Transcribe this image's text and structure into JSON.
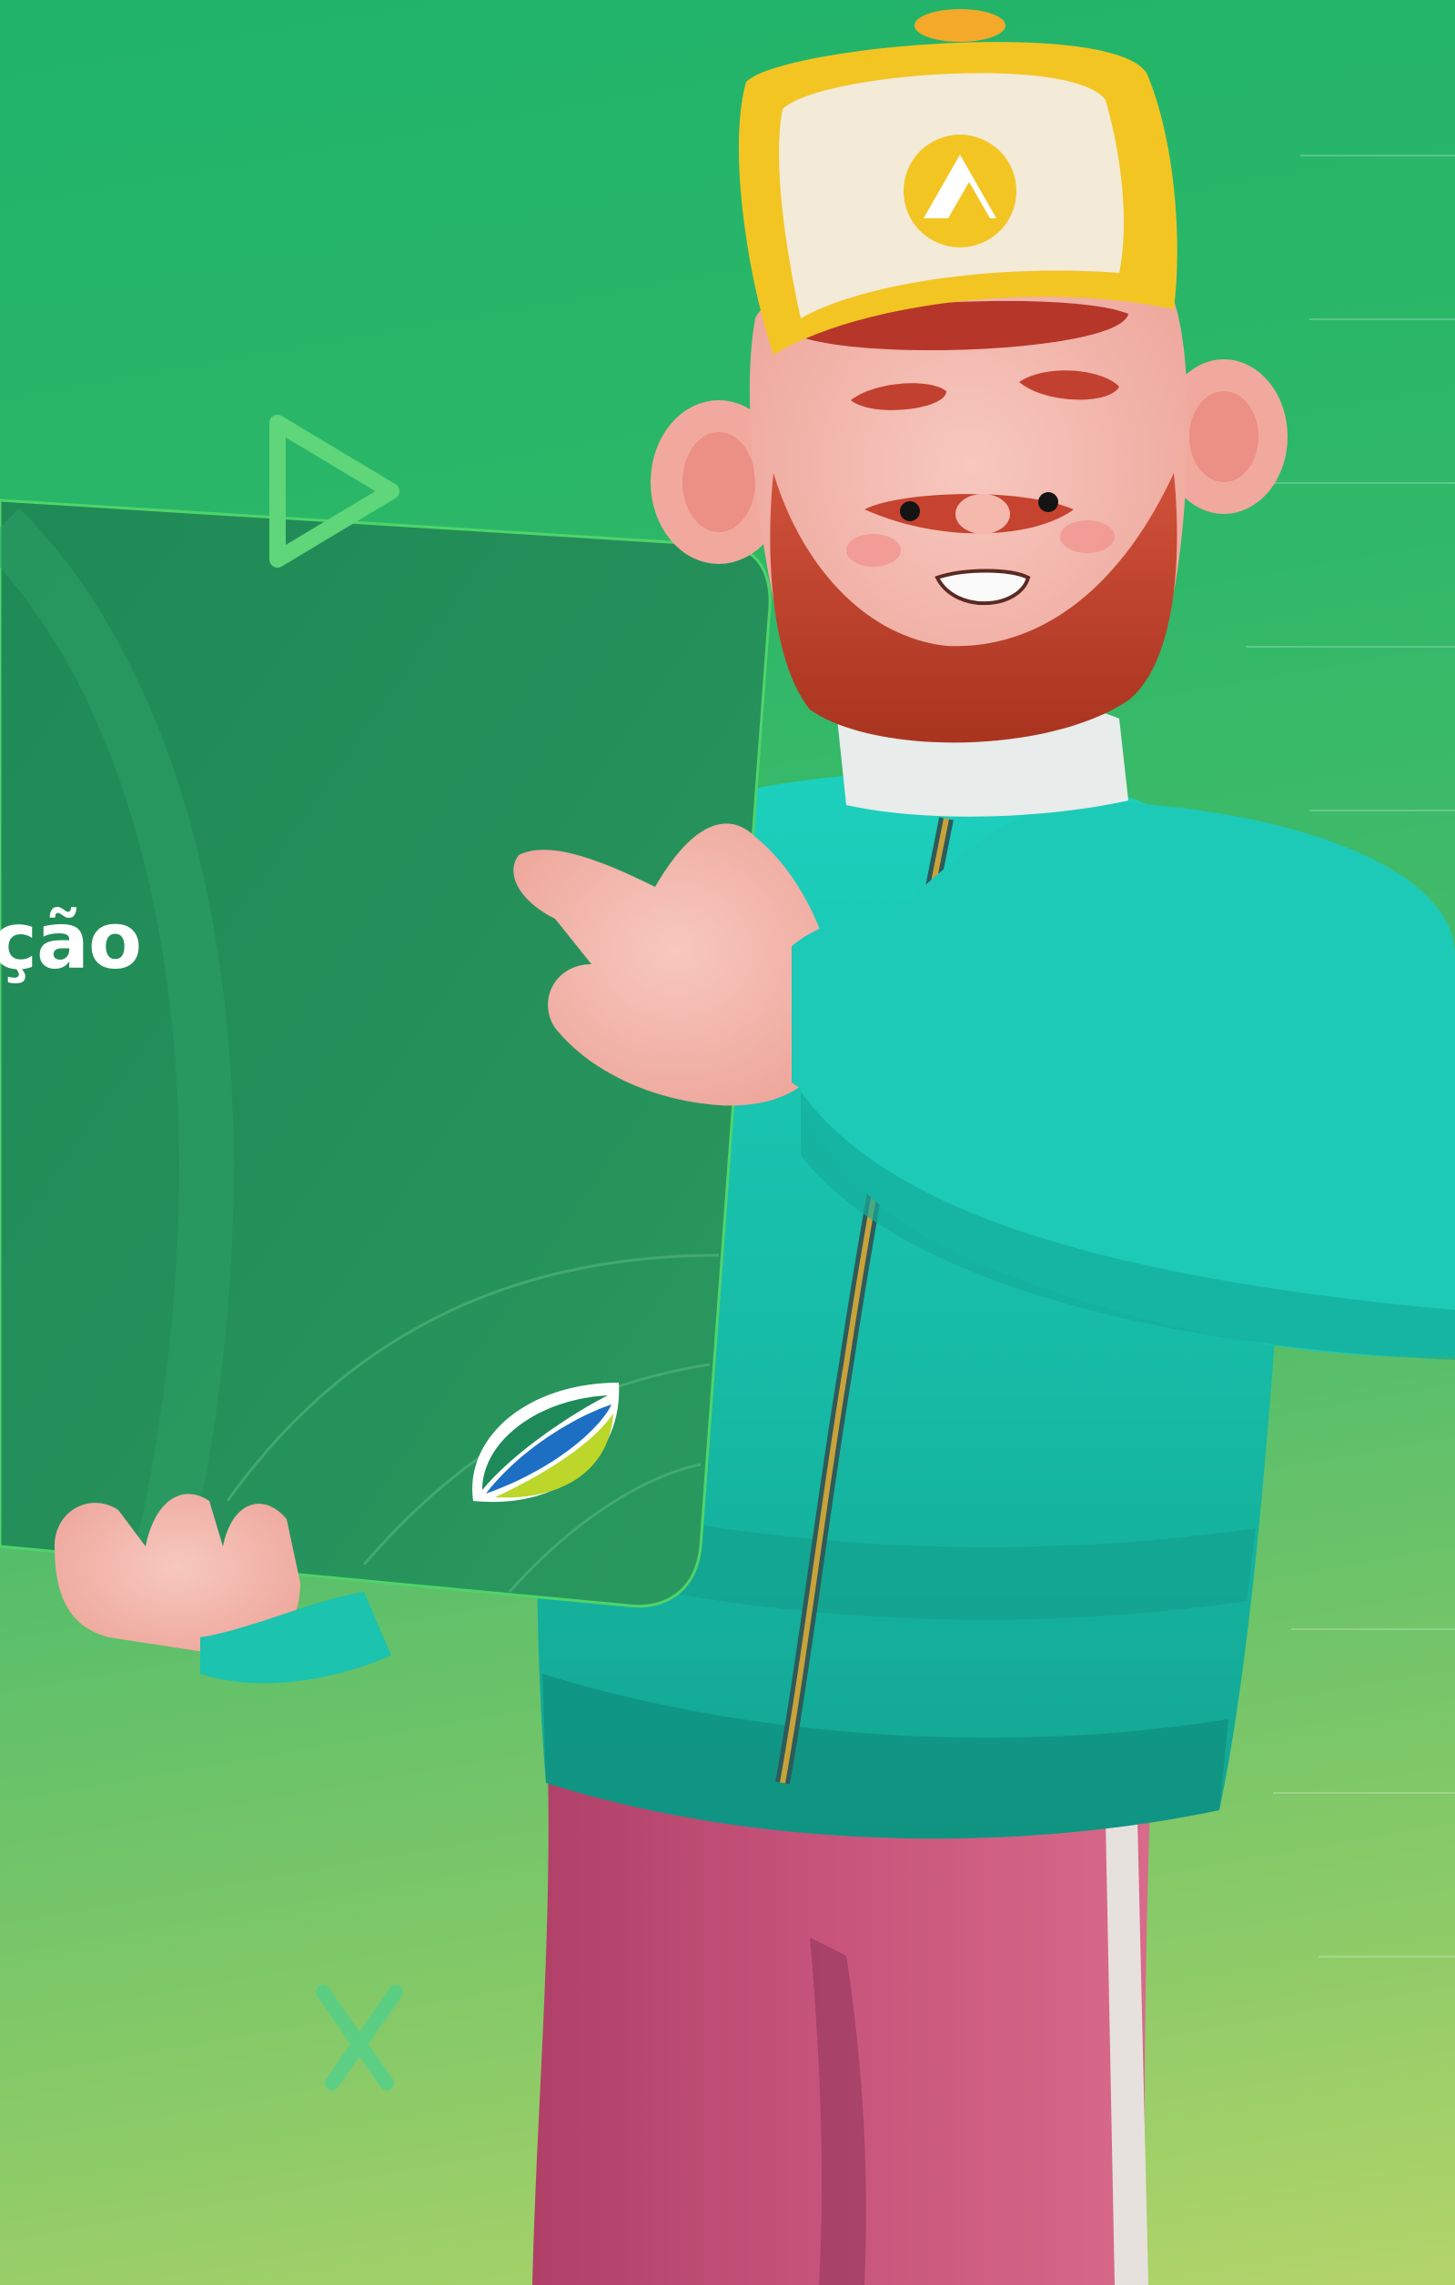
{
  "card": {
    "headline_fragment": "ção"
  },
  "colors": {
    "background_top": "#1fb36a",
    "background_bottom": "#b4d46a",
    "card": "#23915a",
    "jacket": "#19c3ae",
    "pants": "#c4527a",
    "cap_front": "#f3ead8",
    "cap_brim": "#f4c322",
    "beard": "#c6432f"
  },
  "icons": [
    "play-triangle-icon",
    "x-mark-icon",
    "leaf-logo-icon",
    "cap-logo-icon"
  ]
}
